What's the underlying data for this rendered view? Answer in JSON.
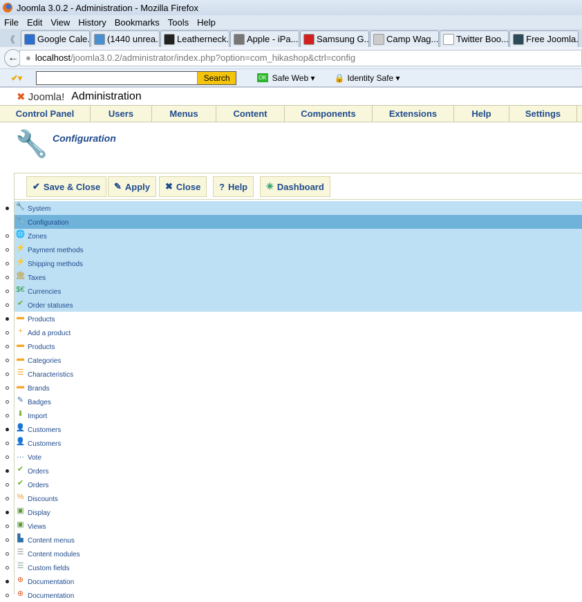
{
  "browser": {
    "title": "Joomla 3.0.2 - Administration - Mozilla Firefox",
    "menu": [
      "File",
      "Edit",
      "View",
      "History",
      "Bookmarks",
      "Tools",
      "Help"
    ],
    "tabs": [
      {
        "label": "Google Cale...",
        "color": "#2a6fd1"
      },
      {
        "label": "(1440 unrea...",
        "color": "#4a8fd0"
      },
      {
        "label": "Leatherneck...",
        "color": "#222"
      },
      {
        "label": "Apple - iPa...",
        "color": "#777"
      },
      {
        "label": "Samsung G...",
        "color": "#d21f1f"
      },
      {
        "label": "Camp Wag...",
        "color": "#ccc"
      },
      {
        "label": "Twitter Boo...",
        "color": "#fff"
      },
      {
        "label": "Free Joomla...",
        "color": "#2c4a5a"
      }
    ],
    "url_host": "localhost",
    "url_path": "/joomla3.0.2/administrator/index.php?option=com_hikashop&ctrl=config",
    "search_button": "Search",
    "safe_web": "Safe Web ▾",
    "identity_safe": "Identity Safe ▾"
  },
  "header": {
    "logo": "Joomla!",
    "title": "Administration"
  },
  "nav": [
    "Control Panel",
    "Users",
    "Menus",
    "Content",
    "Components",
    "Extensions",
    "Help",
    "Settings"
  ],
  "page_title": "Configuration",
  "toolbar": {
    "save_close": "Save & Close",
    "apply": "Apply",
    "close": "Close",
    "help": "Help",
    "dashboard": "Dashboard"
  },
  "menu_items": [
    {
      "label": "System",
      "bullet": "f",
      "state": "hl",
      "icon": "🔧",
      "color": "#3a8fd0"
    },
    {
      "label": "Configuration",
      "bullet": "",
      "state": "sel",
      "icon": "🔧",
      "color": "#3a8fd0"
    },
    {
      "label": "Zones",
      "bullet": "o",
      "state": "hl",
      "icon": "🌐",
      "color": "#2d7fc8"
    },
    {
      "label": "Payment methods",
      "bullet": "o",
      "state": "hl",
      "icon": "⚡",
      "color": "#f2a22c"
    },
    {
      "label": "Shipping methods",
      "bullet": "o",
      "state": "hl",
      "icon": "⚡",
      "color": "#f2a22c"
    },
    {
      "label": "Taxes",
      "bullet": "o",
      "state": "hl",
      "icon": "🏛",
      "color": "#c9962a"
    },
    {
      "label": "Currencies",
      "bullet": "o",
      "state": "hl",
      "icon": "$€",
      "color": "#2a9a3a"
    },
    {
      "label": "Order statuses",
      "bullet": "o",
      "state": "hl",
      "icon": "✔",
      "color": "#6aaa2a"
    },
    {
      "label": "Products",
      "bullet": "f",
      "state": "",
      "icon": "▬",
      "color": "#f5a623"
    },
    {
      "label": "Add a product",
      "bullet": "o",
      "state": "",
      "icon": "+",
      "color": "#f5a623"
    },
    {
      "label": "Products",
      "bullet": "o",
      "state": "",
      "icon": "▬",
      "color": "#f5a623"
    },
    {
      "label": "Categories",
      "bullet": "o",
      "state": "",
      "icon": "▬",
      "color": "#f5a623"
    },
    {
      "label": "Characteristics",
      "bullet": "o",
      "state": "",
      "icon": "☰",
      "color": "#f5a623"
    },
    {
      "label": "Brands",
      "bullet": "o",
      "state": "",
      "icon": "▬",
      "color": "#f5a623"
    },
    {
      "label": "Badges",
      "bullet": "o",
      "state": "",
      "icon": "✎",
      "color": "#2d6fa8"
    },
    {
      "label": "Import",
      "bullet": "o",
      "state": "",
      "icon": "⬇",
      "color": "#7ab02a"
    },
    {
      "label": "Customers",
      "bullet": "f",
      "state": "",
      "icon": "👤",
      "color": "#2d7fc8"
    },
    {
      "label": "Customers",
      "bullet": "o",
      "state": "",
      "icon": "👤",
      "color": "#2d7fc8"
    },
    {
      "label": "Vote",
      "bullet": "o",
      "state": "",
      "icon": "…",
      "color": "#2d6fa8"
    },
    {
      "label": "Orders",
      "bullet": "f",
      "state": "",
      "icon": "✔",
      "color": "#6aaa2a"
    },
    {
      "label": "Orders",
      "bullet": "o",
      "state": "",
      "icon": "✔",
      "color": "#6aaa2a"
    },
    {
      "label": "Discounts",
      "bullet": "o",
      "state": "",
      "icon": "%",
      "color": "#f29a1a"
    },
    {
      "label": "Display",
      "bullet": "f",
      "state": "",
      "icon": "▣",
      "color": "#5a9a3a"
    },
    {
      "label": "Views",
      "bullet": "o",
      "state": "",
      "icon": "▣",
      "color": "#5a9a3a"
    },
    {
      "label": "Content menus",
      "bullet": "o",
      "state": "",
      "icon": "▙",
      "color": "#2d6fa8"
    },
    {
      "label": "Content modules",
      "bullet": "o",
      "state": "",
      "icon": "☰",
      "color": "#999"
    },
    {
      "label": "Custom fields",
      "bullet": "o",
      "state": "",
      "icon": "☰",
      "color": "#8a9"
    },
    {
      "label": "Documentation",
      "bullet": "f",
      "state": "",
      "icon": "⊕",
      "color": "#e0602a"
    },
    {
      "label": "Documentation",
      "bullet": "o",
      "state": "",
      "icon": "⊕",
      "color": "#e0602a"
    }
  ]
}
